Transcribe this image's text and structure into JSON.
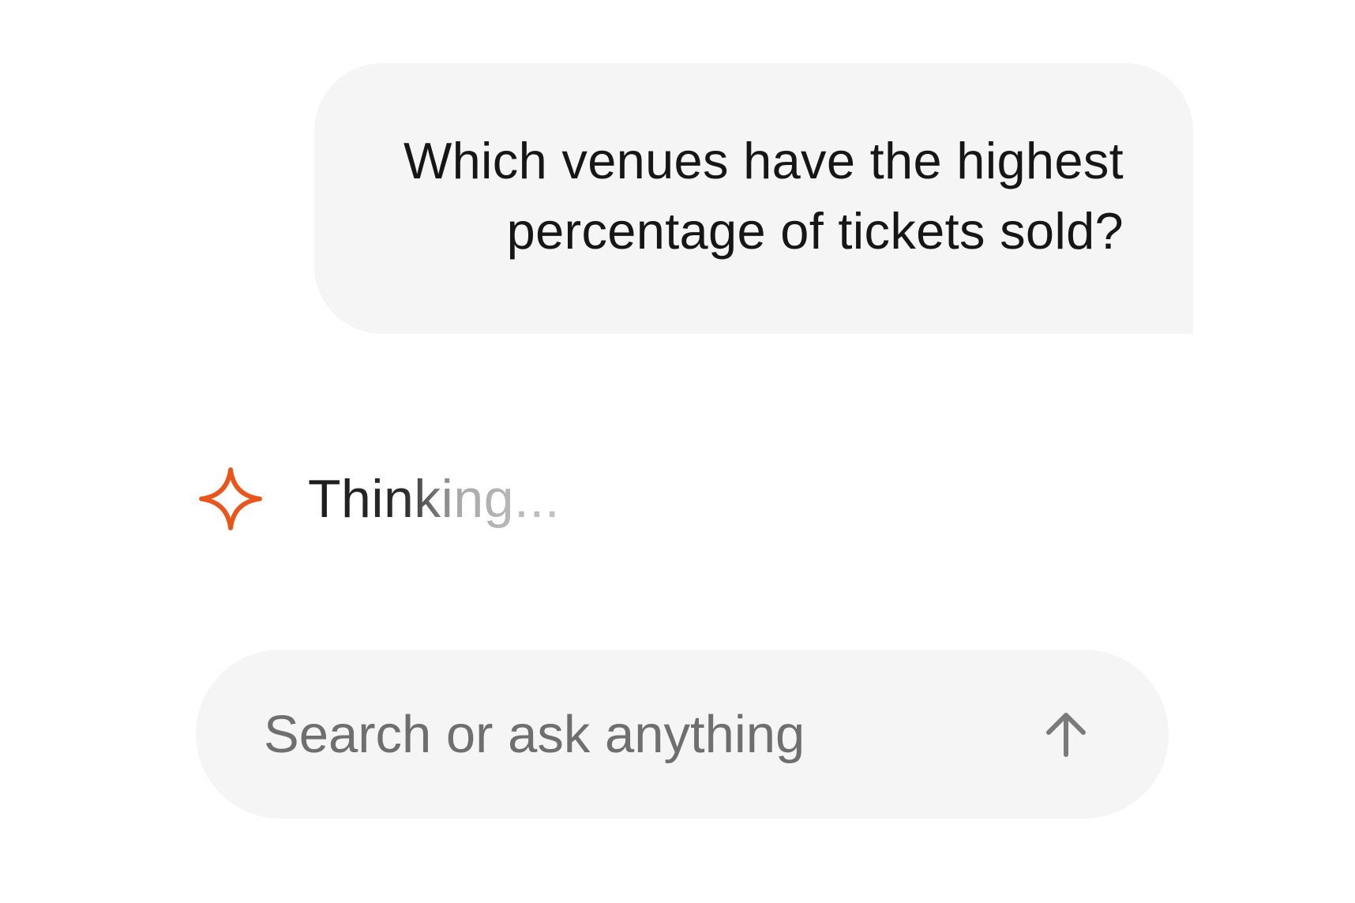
{
  "conversation": {
    "user_message": "Which venues have the highest percentage of tickets sold?",
    "status_text": "Thinking..."
  },
  "composer": {
    "placeholder": "Search or ask anything"
  },
  "icons": {
    "assistant": "sparkle-icon",
    "send": "arrow-up-icon"
  },
  "colors": {
    "accent": "#e8561c",
    "bubble_bg": "#f5f5f5",
    "placeholder_text": "#6f6f6f",
    "send_icon": "#7a7a7a"
  }
}
